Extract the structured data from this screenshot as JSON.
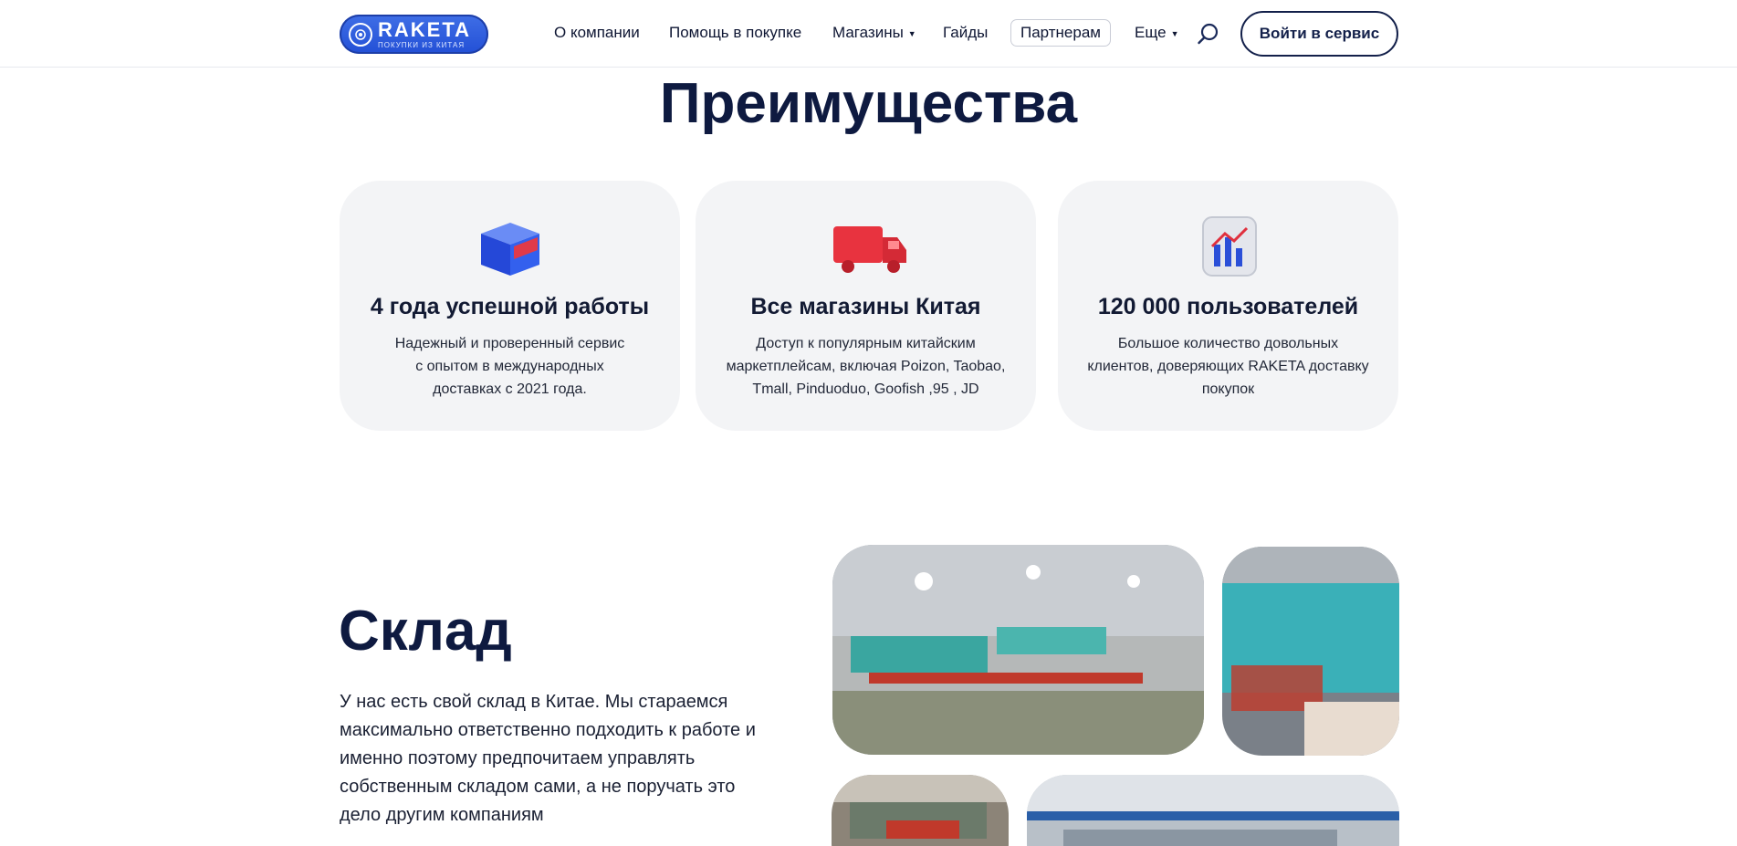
{
  "header": {
    "logo_name": "RAKETA",
    "logo_tagline": "ПОКУПКИ ИЗ КИТАЯ",
    "nav": {
      "about": "О компании",
      "help": "Помощь в покупке",
      "shops": "Магазины",
      "guides": "Гайды",
      "partners": "Партнерам",
      "more": "Еще"
    },
    "login_label": "Войти в сервис"
  },
  "advantages": {
    "title": "Преимущества",
    "cards": [
      {
        "icon": "box-icon",
        "title": "4 года успешной работы",
        "lines": [
          "Надежный и проверенный сервис",
          "с опытом в международных",
          "доставках с 2021 года."
        ]
      },
      {
        "icon": "truck-icon",
        "title": "Все магазины Китая",
        "lines": [
          "Доступ к популярным китайским",
          "маркетплейсам, включая Poizon, Taobao,",
          "Tmall, Pinduoduo, Goofish ,95 , JD"
        ]
      },
      {
        "icon": "chart-icon",
        "title": "120 000 пользователей",
        "lines": [
          "Большое количество довольных",
          "клиентов, доверяющих RAKETA доставку",
          "покупок"
        ]
      }
    ]
  },
  "warehouse": {
    "title": "Склад",
    "text": "У нас есть свой склад в Китае. Мы стараемся максимально ответственно подходить к работе и именно поэтому предпочитаем управлять собственным складом сами, а не поручать это дело другим компаниям"
  },
  "colors": {
    "brand_blue": "#2f5fe0",
    "navy": "#0e1a40",
    "card_bg": "#f3f4f6"
  }
}
